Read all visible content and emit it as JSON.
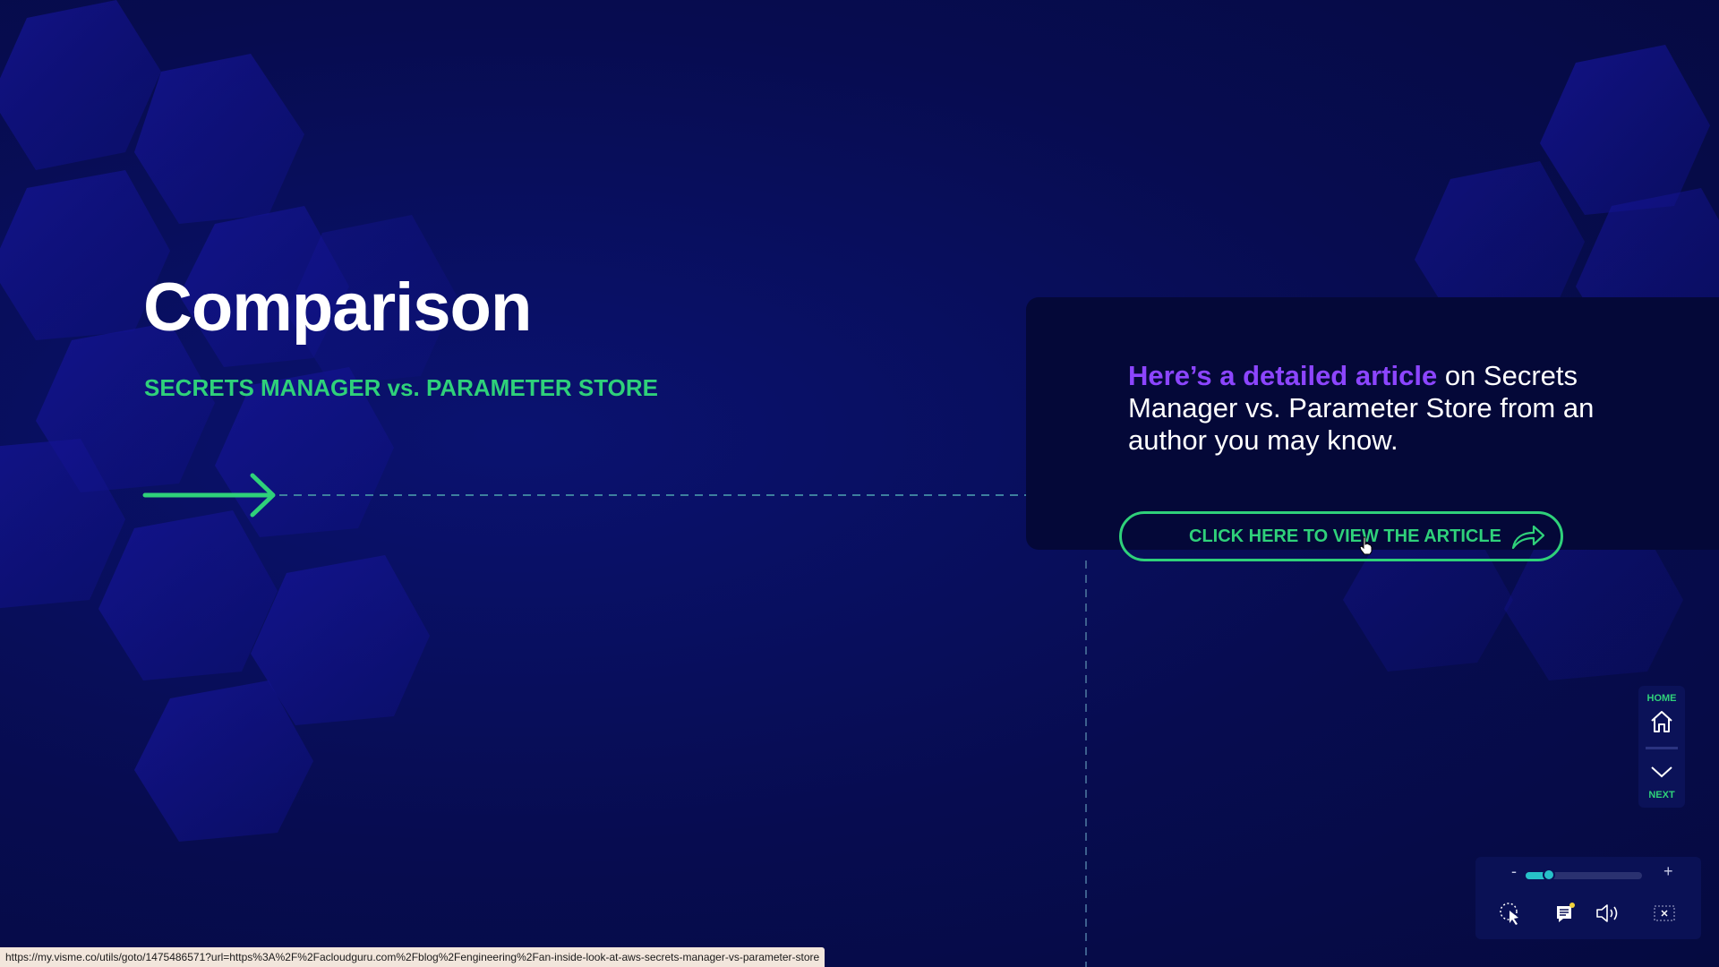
{
  "slide": {
    "title": "Comparison",
    "subtitle": "SECRETS MANAGER vs. PARAMETER STORE"
  },
  "card": {
    "highlight": "Here’s a detailed article",
    "body": " on Secrets Manager vs. Parameter Store from an author you may know.",
    "cta_label": "CLICK HERE TO VIEW THE ARTICLE"
  },
  "nav": {
    "home_label": "HOME",
    "next_label": "NEXT"
  },
  "controls": {
    "zoom_minus": "-",
    "zoom_plus": "+",
    "zoom_level": 0.2
  },
  "status_bar": {
    "url": "https://my.visme.co/utils/goto/1475486571?url=https%3A%2F%2Facloudguru.com%2Fblog%2Fengineering%2Fan-inside-look-at-aws-secrets-manager-vs-parameter-store"
  },
  "colors": {
    "accent_green": "#2fd17a",
    "accent_purple": "#8c45ff",
    "background": "#070c4d",
    "card_bg": "#040838",
    "slider": "#27c2c9"
  }
}
